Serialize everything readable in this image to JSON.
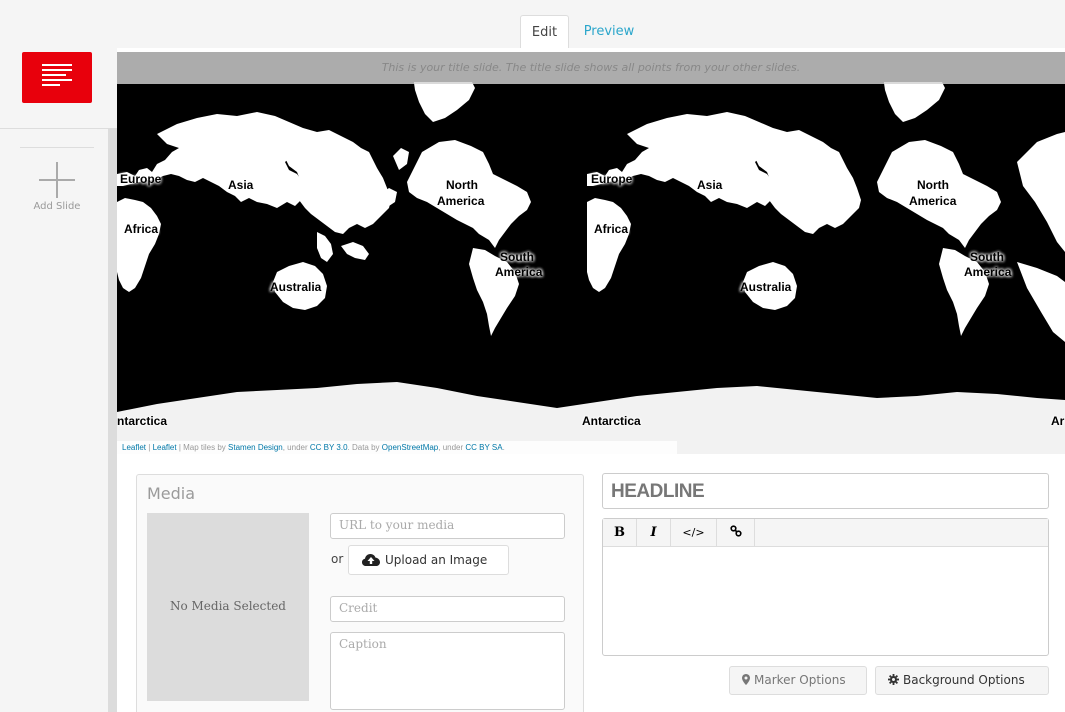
{
  "tabs": {
    "edit_label": "Edit",
    "preview_label": "Preview"
  },
  "sidebar": {
    "add_slide_label": "Add Slide"
  },
  "map": {
    "banner_text": "This is your title slide. The title slide shows all points from your other slides.",
    "labels": {
      "europe_1": "Europe",
      "asia_1": "Asia",
      "africa_1": "Africa",
      "north_america_1a": "North",
      "north_america_1b": "America",
      "south_america_1a": "South",
      "south_america_1b": "America",
      "australia_1": "Australia",
      "antarctica_1": "ntarctica",
      "europe_2": "Europe",
      "asia_2": "Asia",
      "africa_2": "Africa",
      "north_america_2a": "North",
      "north_america_2b": "America",
      "south_america_2a": "South",
      "south_america_2b": "America",
      "australia_2": "Australia",
      "antarctica_2": "Antarctica",
      "antarctica_3": "Ar"
    },
    "attribution": {
      "leaflet_1": "Leaflet",
      "sep_1": " | ",
      "leaflet_2": "Leaflet",
      "text_1": " | Map tiles by ",
      "stamen": "Stamen Design",
      "text_2": ", under ",
      "cc_by": "CC BY 3.0",
      "text_3": ". Data by ",
      "osm": "OpenStreetMap",
      "text_4": ", under ",
      "cc_by_sa": "CC BY SA",
      "text_5": "."
    }
  },
  "media": {
    "title": "Media",
    "no_media_label": "No Media Selected",
    "url_placeholder": "URL to your media",
    "or_label": "or",
    "upload_label": "Upload an Image",
    "credit_placeholder": "Credit",
    "caption_placeholder": "Caption"
  },
  "text": {
    "headline_placeholder": "HEADLINE",
    "toolbar": {
      "bold": "B",
      "italic": "I",
      "code": "</>",
      "link": "%"
    }
  },
  "options": {
    "marker_label": "Marker Options",
    "background_label": "Background Options"
  },
  "colors": {
    "accent_red": "#e8000c",
    "link_blue": "#2ba6cb"
  },
  "icons": {
    "slide_thumb": "text-lines-icon",
    "add_slide": "plus-icon",
    "upload": "cloud-upload-icon",
    "marker": "map-marker-icon",
    "background": "gear-icon",
    "link": "link-icon"
  }
}
